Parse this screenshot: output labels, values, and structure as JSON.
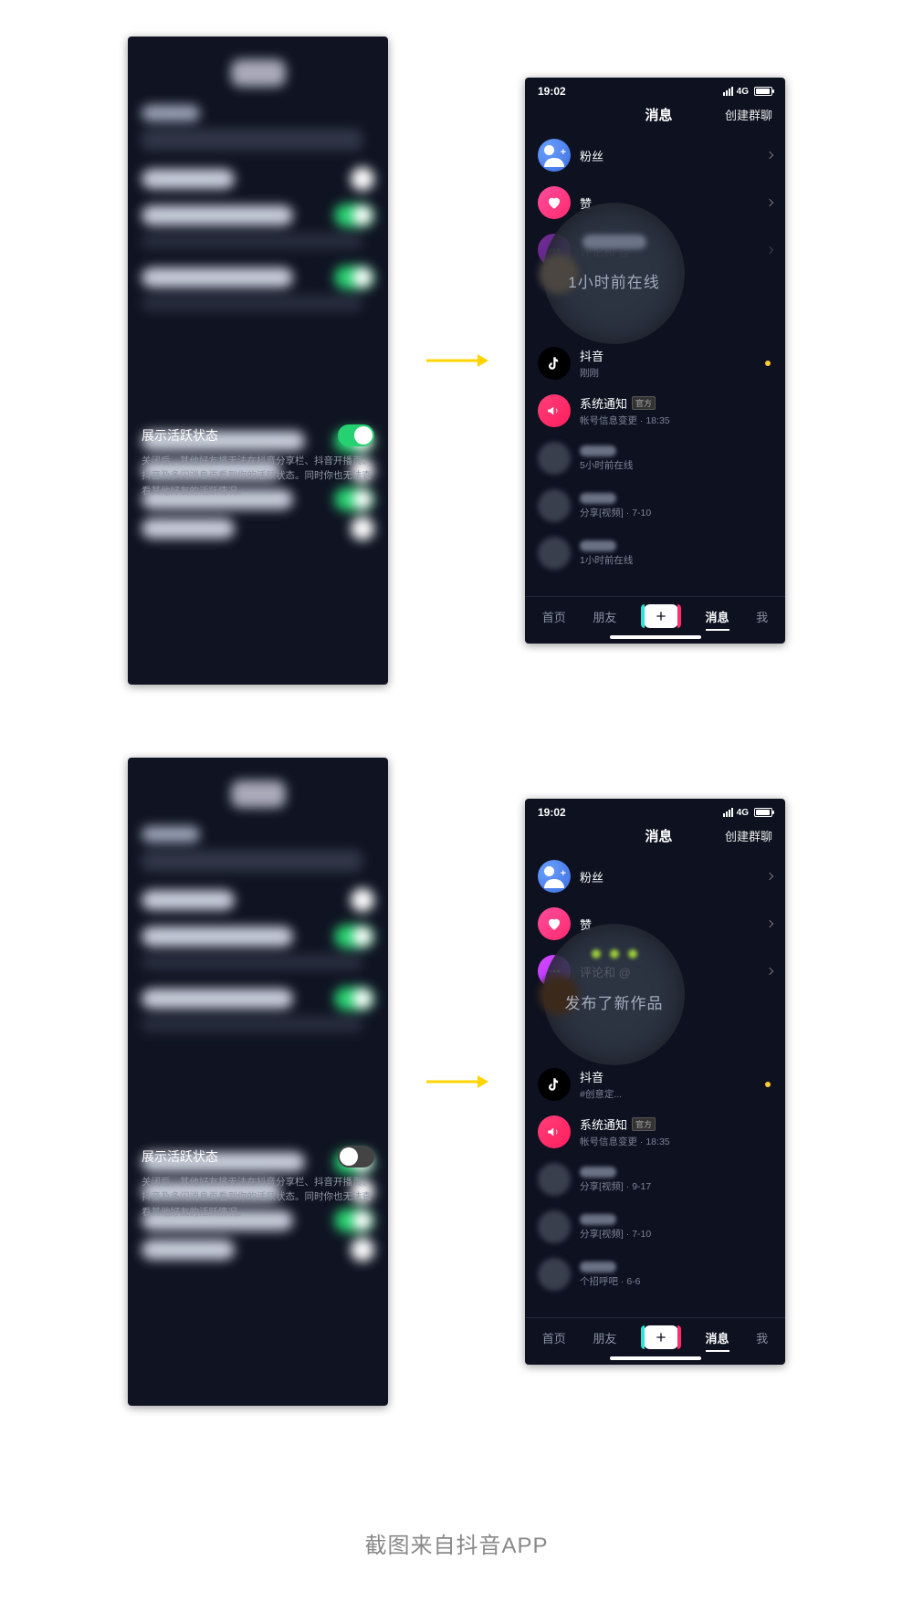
{
  "caption": "截图来自抖音APP",
  "setting": {
    "title": "展示活跃状态",
    "description": "关闭后，其他好友将无法在抖音分享栏、抖音开播页、抖音及多闪消息页看到你的活跃状态。同时你也无法查看其他好友的活跃情况。"
  },
  "status": {
    "time": "19:02",
    "net": "4G"
  },
  "nav": {
    "title": "消息",
    "action": "创建群聊"
  },
  "tabs": {
    "home": "首页",
    "friends": "朋友",
    "messages": "消息",
    "me": "我"
  },
  "msg": {
    "fans": "粉丝",
    "like": "赞",
    "comment": "评论和 @",
    "douyin": "抖音",
    "douyin_sub2": "#创意定...",
    "douyin_sub1_time": "刚刚",
    "notify_title": "系统通知",
    "notify_badge": "官方",
    "notify_sub": "帐号信息变更",
    "notify_time": "18:35",
    "chatA1_sub": "5小时前在线",
    "chatA2_sub": "分享[视频]",
    "chatA2_time": "7-10",
    "chatA3_sub": "1小时前在线",
    "chatB1_sub": "分享[视频]",
    "chatB1_time": "9-17",
    "chatB2_sub": "分享[视频]",
    "chatB2_time": "7-10",
    "chatB3_sub": "个招呼吧",
    "chatB3_time": "6-6"
  },
  "highlight": {
    "variant_on": "1小时前在线",
    "variant_off": "发布了新作品"
  }
}
